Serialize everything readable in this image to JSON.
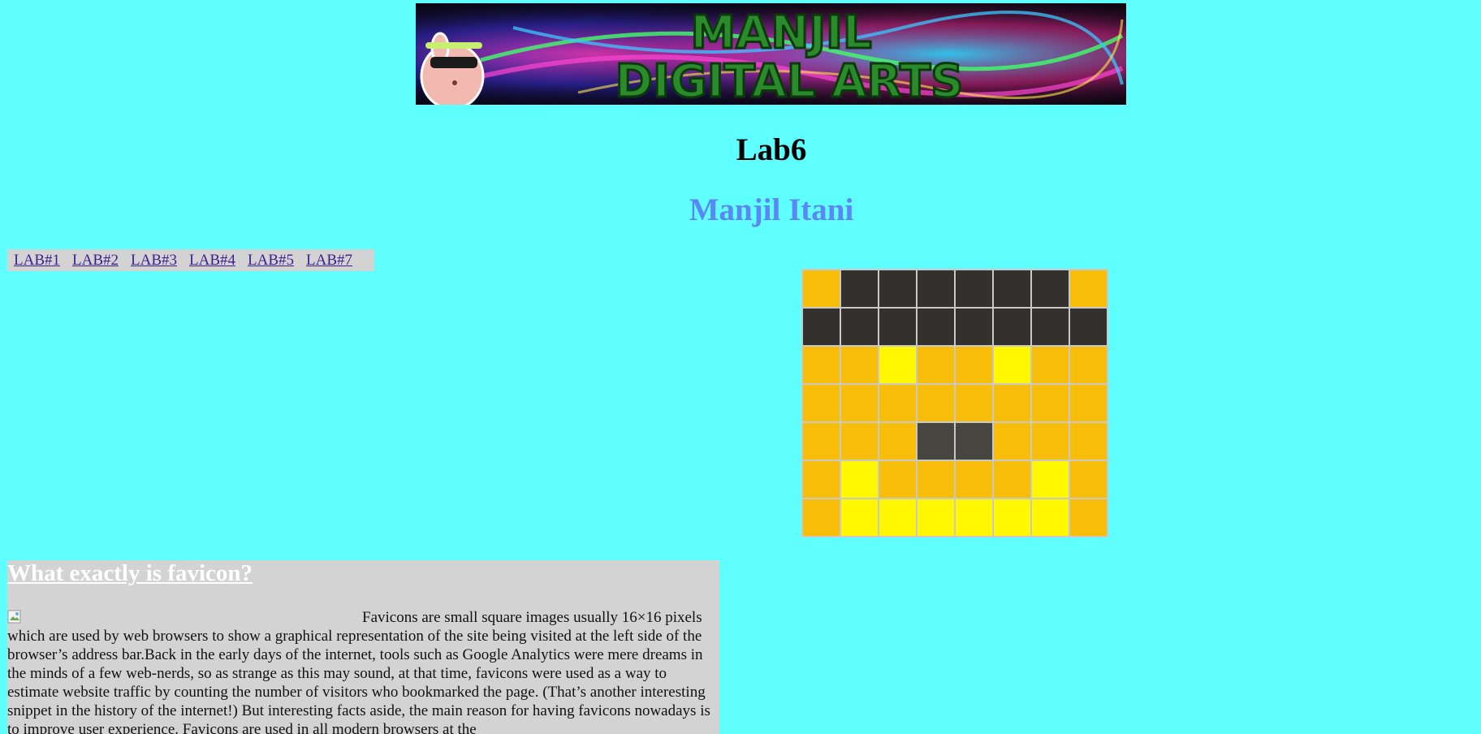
{
  "header": {
    "banner_text_line1": "MANJIL",
    "banner_text_line2": "DIGITAL ARTS",
    "title": "Lab6",
    "author": "Manjil Itani"
  },
  "nav": {
    "links": [
      "LAB#1",
      "LAB#2",
      "LAB#3",
      "LAB#4",
      "LAB#5",
      "LAB#7"
    ]
  },
  "pixel_art": {
    "colors": {
      "O": "#f7bd08",
      "D": "#33312d",
      "Y": "#fff800",
      "G": "#474540"
    },
    "rows": [
      "ODDDDDDO",
      "DDDDDDDD",
      "OOYOOYOO",
      "OOOOOOOO",
      "OOOGGOOO",
      "OYOOOOYO",
      "OYYYYYYO"
    ]
  },
  "article": {
    "heading": "What exactly is favicon?",
    "body": "Favicons are small square images usually 16×16 pixels which are used by web browsers to show a graphical representation of the site being visited at the left side of the browser’s address bar.Back in the early days of the internet, tools such as Google Analytics were mere dreams in the minds of a few web-nerds, so as strange as this may sound, at that time, favicons were used as a way to estimate website traffic by counting the number of visitors who bookmarked the page. (That’s another interesting snippet in the history of the internet!) But interesting facts aside, the main reason for having favicons nowadays is to improve user experience. Favicons are used in all modern browsers at the"
  }
}
